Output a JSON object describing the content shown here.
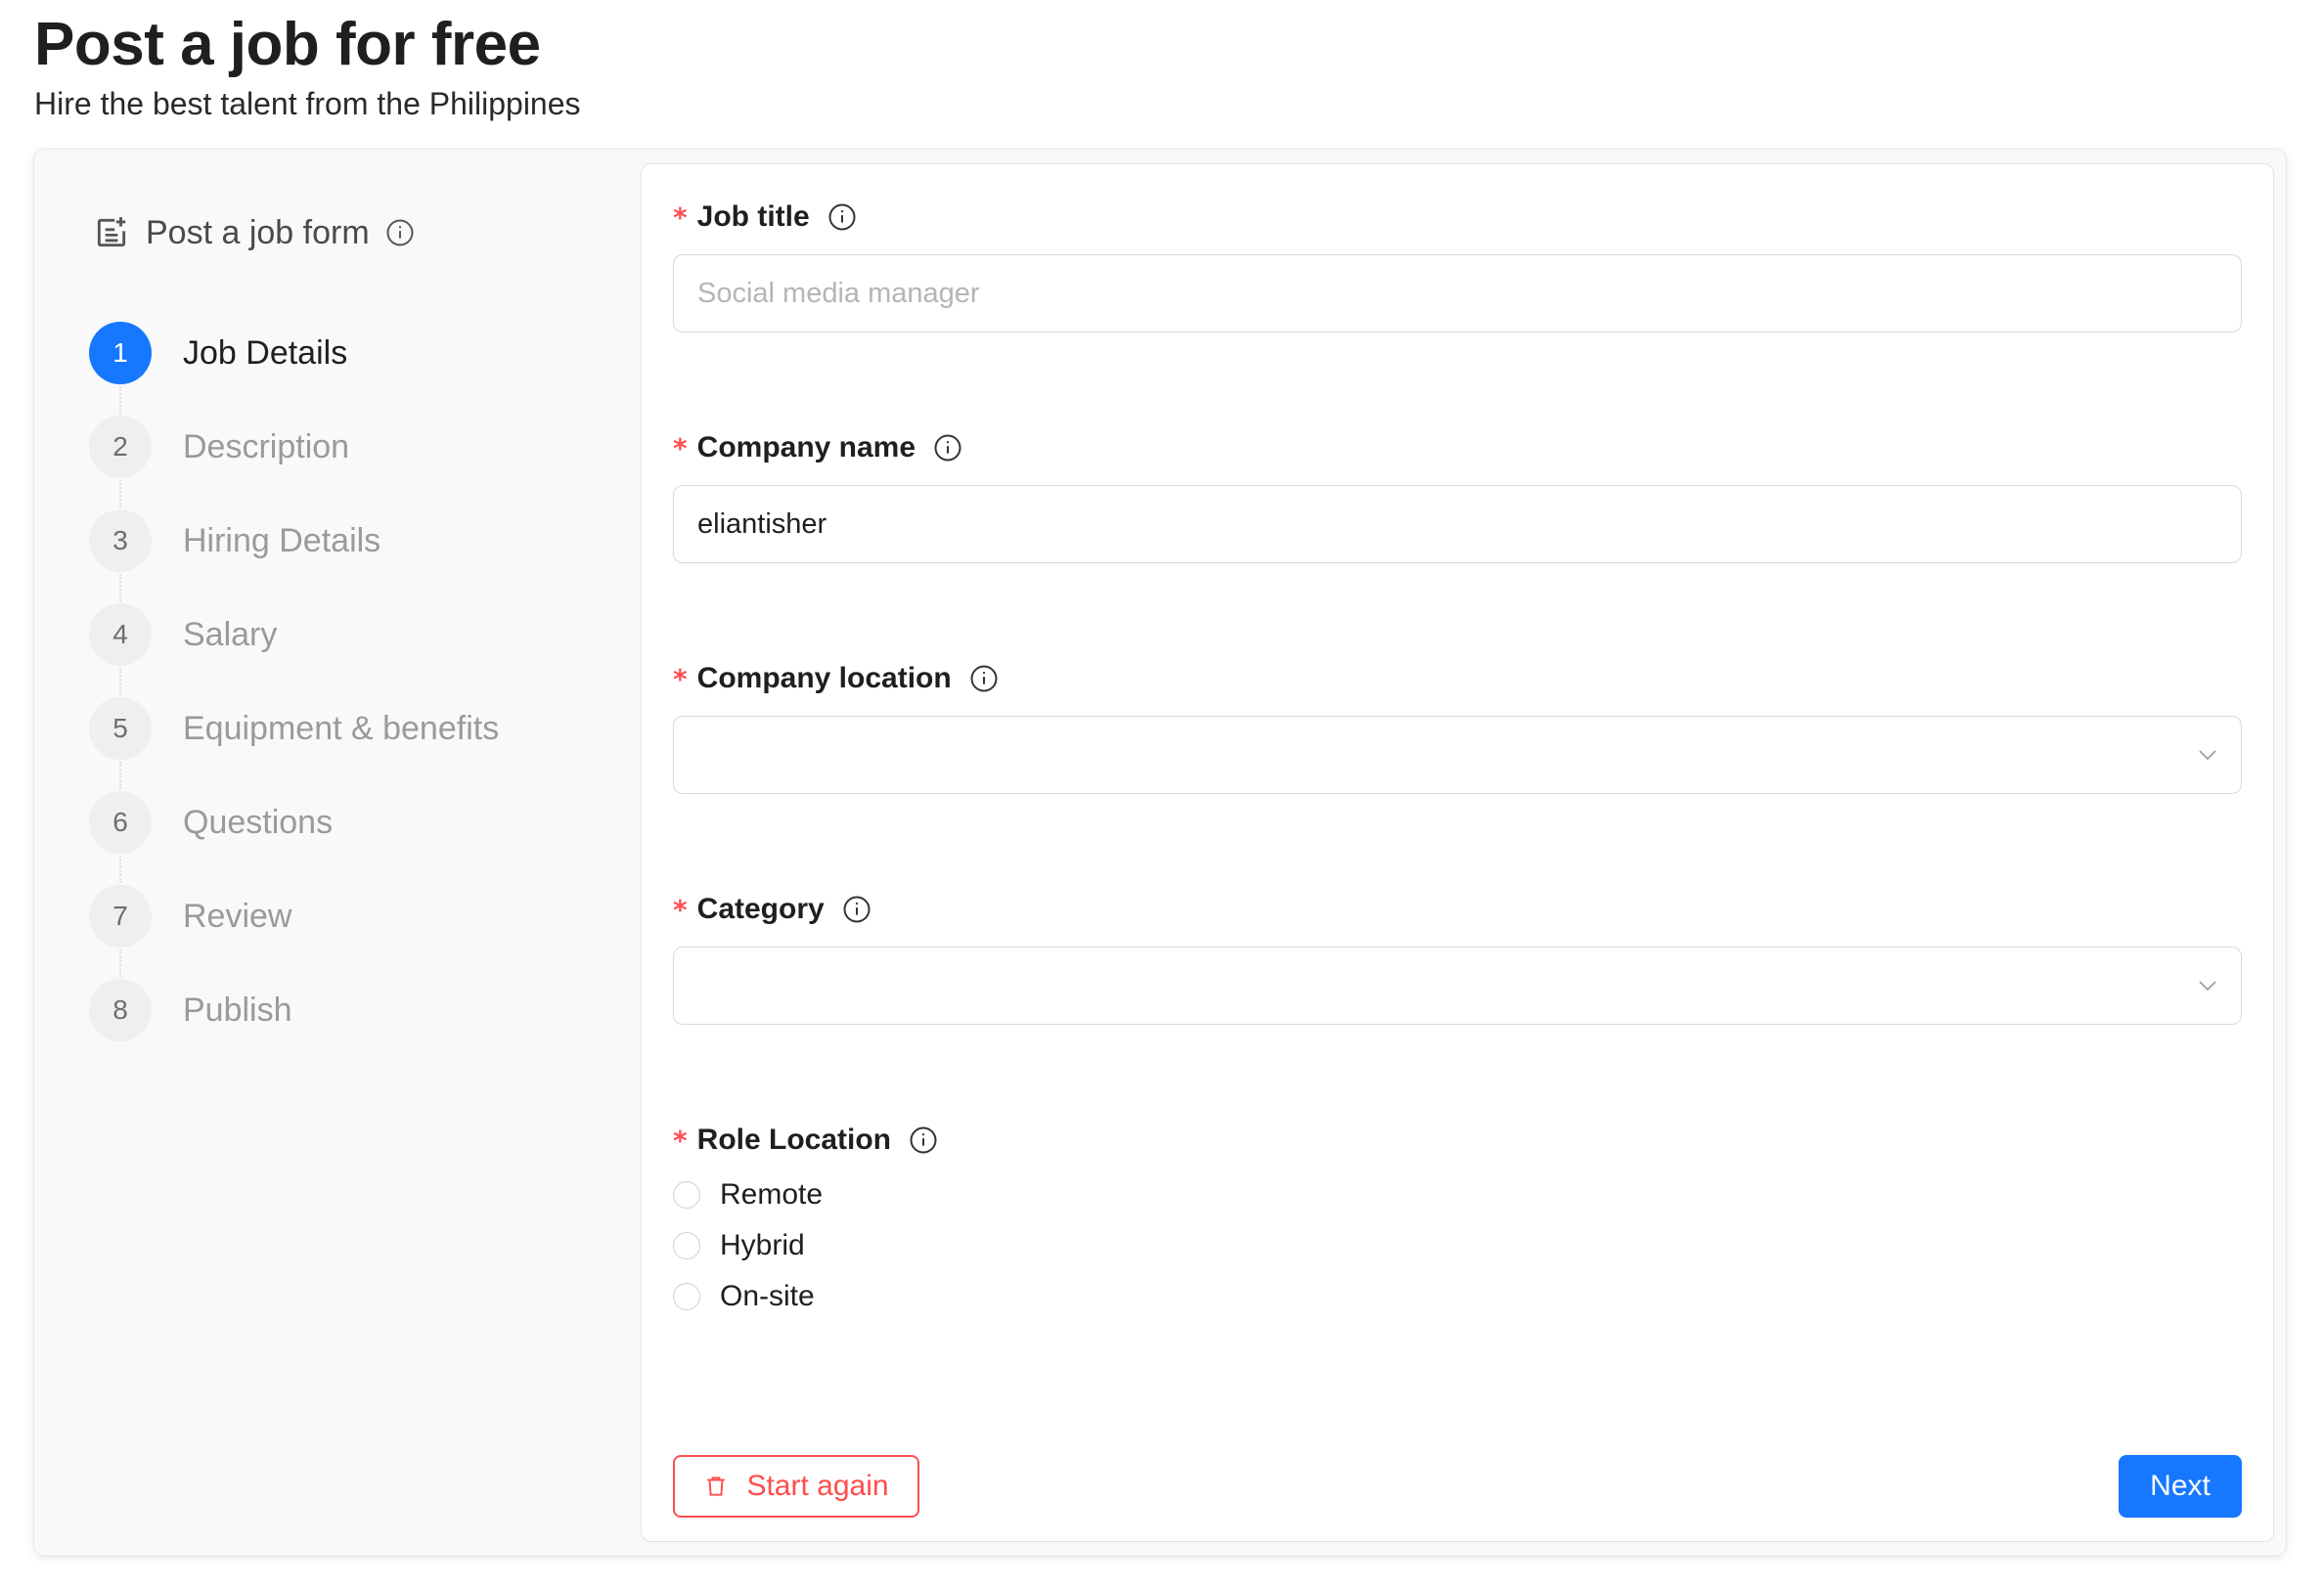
{
  "header": {
    "title": "Post a job for free",
    "subtitle": "Hire the best talent from the Philippines"
  },
  "sidebar": {
    "title": "Post a job form",
    "steps": [
      {
        "number": "1",
        "label": "Job Details",
        "active": true
      },
      {
        "number": "2",
        "label": "Description"
      },
      {
        "number": "3",
        "label": "Hiring Details"
      },
      {
        "number": "4",
        "label": "Salary"
      },
      {
        "number": "5",
        "label": "Equipment & benefits"
      },
      {
        "number": "6",
        "label": "Questions"
      },
      {
        "number": "7",
        "label": "Review"
      },
      {
        "number": "8",
        "label": "Publish"
      }
    ]
  },
  "form": {
    "required_marker": "*",
    "job_title": {
      "label": "Job title",
      "value": "",
      "placeholder": "Social media manager"
    },
    "company_name": {
      "label": "Company name",
      "value": "eliantisher",
      "placeholder": ""
    },
    "company_location": {
      "label": "Company location",
      "value": ""
    },
    "category": {
      "label": "Category",
      "value": ""
    },
    "role_location": {
      "label": "Role Location",
      "options": [
        "Remote",
        "Hybrid",
        "On-site"
      ]
    }
  },
  "actions": {
    "start_again": "Start again",
    "next": "Next"
  },
  "colors": {
    "primary": "#1677ff",
    "danger": "#ff4d4f"
  },
  "icons": [
    "form-icon",
    "info-icon",
    "chevron-down-icon",
    "trash-icon"
  ]
}
